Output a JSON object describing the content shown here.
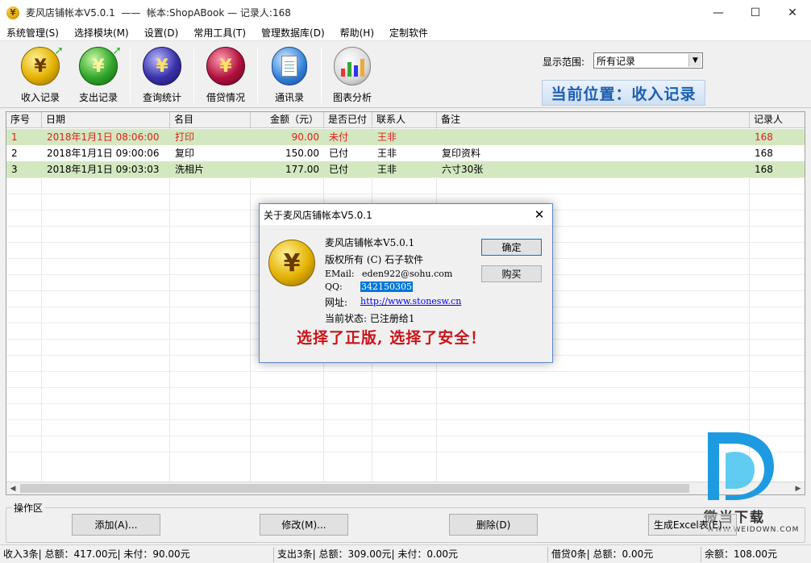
{
  "window": {
    "title": "麦风店铺帐本V5.0.1  ——  帐本:ShopABook — 记录人:168",
    "controls": {
      "minimize": "—",
      "maximize": "☐",
      "close": "✕"
    }
  },
  "menu": [
    "系统管理(S)",
    "选择模块(M)",
    "设置(D)",
    "常用工具(T)",
    "管理数据库(D)",
    "帮助(H)",
    "定制软件"
  ],
  "toolbar": {
    "buttons": [
      {
        "label": "收入记录",
        "icon": "income-coin-icon"
      },
      {
        "label": "支出记录",
        "icon": "expense-coin-icon"
      },
      {
        "label": "查询统计",
        "icon": "query-coin-icon"
      },
      {
        "label": "借贷情况",
        "icon": "loan-coin-icon"
      },
      {
        "label": "通讯录",
        "icon": "contacts-doc-icon"
      },
      {
        "label": "图表分析",
        "icon": "chart-icon"
      }
    ],
    "coin_glyph": "¥",
    "scope_label": "显示范围:",
    "scope_value": "所有记录",
    "location": "当前位置：收入记录"
  },
  "table": {
    "columns": [
      "序号",
      "日期",
      "名目",
      "金额（元）",
      "是否已付",
      "联系人",
      "备注",
      "记录人"
    ],
    "rows": [
      {
        "no": "1",
        "date": "2018年1月1日 08:06:00",
        "item": "打印",
        "amount": "90.00",
        "paid": "未付",
        "contact": "王非",
        "note": "",
        "recorder": "168",
        "unpaid": true
      },
      {
        "no": "2",
        "date": "2018年1月1日 09:00:06",
        "item": "复印",
        "amount": "150.00",
        "paid": "已付",
        "contact": "王非",
        "note": "复印资料",
        "recorder": "168",
        "unpaid": false
      },
      {
        "no": "3",
        "date": "2018年1月1日 09:03:03",
        "item": "洗相片",
        "amount": "177.00",
        "paid": "已付",
        "contact": "王非",
        "note": "六寸30张",
        "recorder": "168",
        "unpaid": false
      }
    ]
  },
  "operations": {
    "group_label": "操作区",
    "add": "添加(A)...",
    "edit": "修改(M)...",
    "delete": "删除(D)",
    "excel": "生成Excel表(E)..."
  },
  "status": {
    "income": "收入3条| 总额：417.00元| 未付：90.00元",
    "expense": "支出3条| 总额：309.00元| 未付：0.00元",
    "loan": "借贷0条| 总额：0.00元",
    "balance": "余额：108.00元"
  },
  "dialog": {
    "title": "关于麦风店铺帐本V5.0.1",
    "app_name": "麦风店铺帐本V5.0.1",
    "copyright": "版权所有 (C) 石子软件",
    "email_label": "EMail:",
    "email": "eden922@sohu.com",
    "qq_label": "QQ:",
    "qq": "342150305",
    "site_label": "网址:",
    "site": "http://www.stonesw.cn",
    "status": "当前状态: 已注册给1",
    "slogan": "选择了正版, 选择了安全！",
    "ok": "确定",
    "buy": "购买",
    "close": "✕"
  },
  "watermark": {
    "name": "微当下载",
    "url": "WWW.WEIDOWN.COM"
  },
  "colors": {
    "selected_row": "#d3e8c0",
    "unpaid_text": "#e0201a",
    "location_text": "#1b5fb0",
    "slogan": "#c8141a"
  }
}
